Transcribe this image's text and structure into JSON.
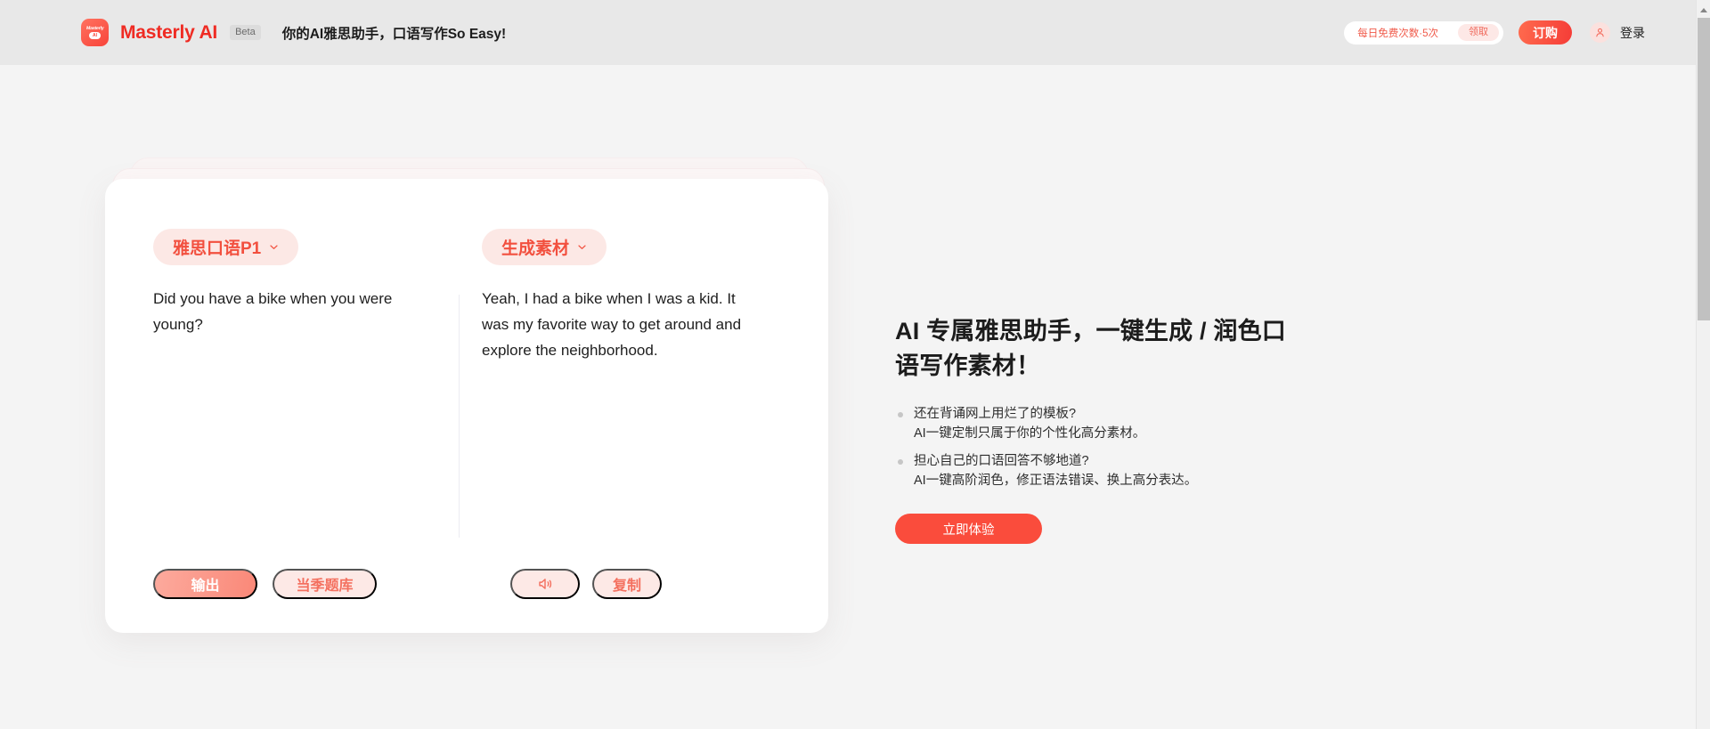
{
  "header": {
    "logo": {
      "top_text": "Masterly",
      "pill_text": "AI",
      "icon": "app-logo-icon"
    },
    "brand": "Masterly AI",
    "beta_badge": "Beta",
    "tagline": "你的AI雅思助手，口语写作So Easy!",
    "free_quota": {
      "text": "每日免费次数·5次",
      "claim_label": "领取"
    },
    "buy_label": "订购",
    "login_label": "登录",
    "avatar_icon": "user-icon",
    "colors": {
      "bar_bg": "#e8e8e8",
      "brand": "#ef2b23",
      "accent": "#fa4c3c"
    }
  },
  "scrollbar": {
    "arrow_icon": "scroll-up-arrow-icon"
  },
  "card": {
    "left_tag": {
      "label": "雅思口语P1",
      "chevron_icon": "chevron-down-icon"
    },
    "right_tag": {
      "label": "生成素材",
      "chevron_icon": "chevron-down-icon"
    },
    "left_text": "Did you have a bike when you were young?",
    "right_text": "Yeah, I had a bike when I was a kid. It was my favorite way to get around and explore the neighborhood.",
    "buttons": {
      "output": "输出",
      "question_bank": "当季题库",
      "speaker_icon": "volume-speaker-icon",
      "copy": "复制"
    }
  },
  "right_pane": {
    "title": "AI 专属雅思助手，一键生成 / 润色口语写作素材！",
    "bullets": [
      {
        "line1": "还在背诵网上用烂了的模板?",
        "line2": "AI一键定制只属于你的个性化高分素材。"
      },
      {
        "line1": "担心自己的口语回答不够地道?",
        "line2": "AI一键高阶润色，修正语法错误、换上高分表达。"
      }
    ],
    "cta_label": "立即体验"
  }
}
